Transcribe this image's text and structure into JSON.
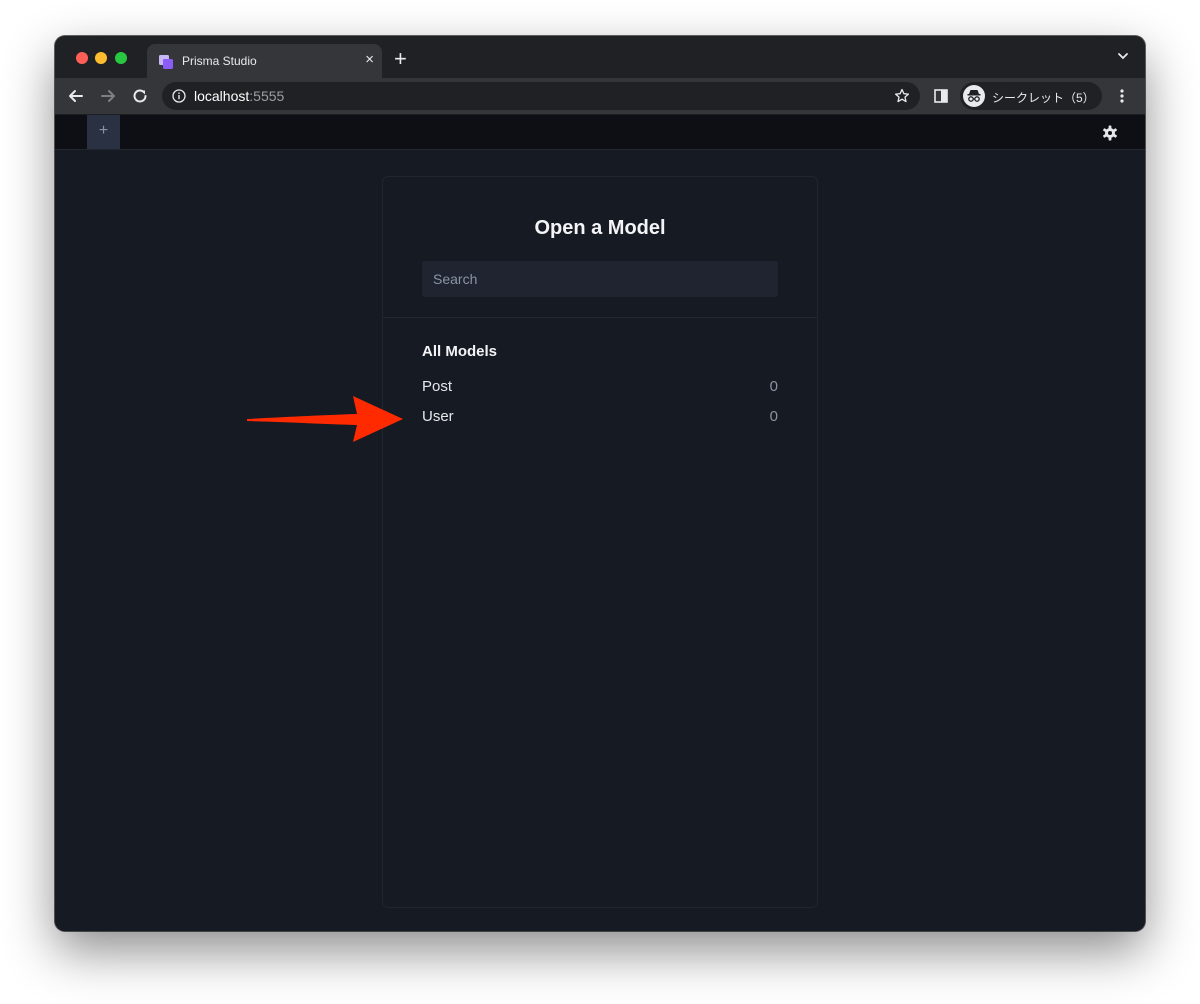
{
  "browser": {
    "tab_title": "Prisma Studio",
    "tab_close": "×",
    "new_tab": "+",
    "url_host": "localhost",
    "url_port": ":5555",
    "profile_label": "シークレット（5）"
  },
  "app": {
    "add_tab": "+"
  },
  "modal": {
    "title": "Open a Model",
    "search_placeholder": "Search",
    "section_title": "All Models",
    "models": [
      {
        "name": "Post",
        "count": "0"
      },
      {
        "name": "User",
        "count": "0"
      }
    ]
  },
  "colors": {
    "annotation_arrow": "#ff2a00",
    "background": "#161a22",
    "app_bar": "#0d0f14"
  }
}
